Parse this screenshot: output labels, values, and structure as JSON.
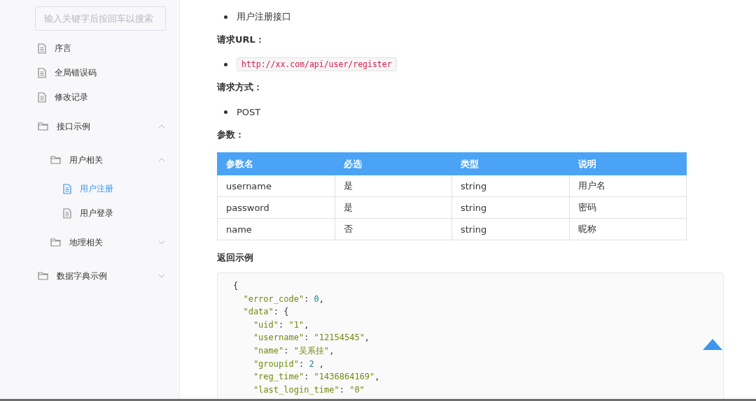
{
  "search": {
    "placeholder": "输入关键字后按回车以搜索"
  },
  "sidebar": {
    "items": [
      {
        "label": "序言",
        "kind": "document",
        "selected": false
      },
      {
        "label": "全局错误码",
        "kind": "document",
        "selected": false
      },
      {
        "label": "修改记录",
        "kind": "document",
        "selected": false
      },
      {
        "label": "接口示例",
        "kind": "folder",
        "expanded": true,
        "children": [
          {
            "label": "用户相关",
            "kind": "folder",
            "expanded": true,
            "children": [
              {
                "label": "用户注册",
                "kind": "document",
                "selected": true
              },
              {
                "label": "用户登录",
                "kind": "document",
                "selected": false
              }
            ]
          },
          {
            "label": "地理相关",
            "kind": "folder",
            "expanded": false
          }
        ]
      },
      {
        "label": "数据字典示例",
        "kind": "folder",
        "expanded": false
      }
    ]
  },
  "content": [
    {
      "kind": "bullet",
      "text": "用户注册接口"
    },
    {
      "kind": "heading",
      "text": "请求URL："
    },
    {
      "kind": "code_bullet",
      "text": "http://xx.com/api/user/register"
    },
    {
      "kind": "heading",
      "text": "请求方式："
    },
    {
      "kind": "bullet",
      "text": "POST"
    },
    {
      "kind": "heading",
      "text": "参数："
    },
    {
      "kind": "table",
      "columns": [
        "参数名",
        "必选",
        "类型",
        "说明"
      ],
      "rows": [
        [
          "username",
          "是",
          "string",
          "用户名"
        ],
        [
          "password",
          "是",
          "string",
          "密码"
        ],
        [
          "name",
          "否",
          "string",
          "昵称"
        ]
      ]
    },
    {
      "kind": "heading",
      "text": "返回示例"
    },
    {
      "kind": "code",
      "lines": [
        [
          {
            "text": "{",
            "kind": "punct"
          }
        ],
        [
          {
            "text": "  \"error_code\"",
            "kind": "string"
          },
          {
            "text": ": ",
            "kind": "punct"
          },
          {
            "text": "0",
            "kind": "number"
          },
          {
            "text": ",",
            "kind": "punct"
          }
        ],
        [
          {
            "text": "  \"data\"",
            "kind": "string"
          },
          {
            "text": ": {",
            "kind": "punct"
          }
        ],
        [
          {
            "text": "    \"uid\"",
            "kind": "string"
          },
          {
            "text": ": ",
            "kind": "punct"
          },
          {
            "text": "\"1\"",
            "kind": "string"
          },
          {
            "text": ",",
            "kind": "punct"
          }
        ],
        [
          {
            "text": "    \"username\"",
            "kind": "string"
          },
          {
            "text": ": ",
            "kind": "punct"
          },
          {
            "text": "\"12154545\"",
            "kind": "string"
          },
          {
            "text": ",",
            "kind": "punct"
          }
        ],
        [
          {
            "text": "    \"name\"",
            "kind": "string"
          },
          {
            "text": ": ",
            "kind": "punct"
          },
          {
            "text": "\"吴系挂\"",
            "kind": "string"
          },
          {
            "text": ",",
            "kind": "punct"
          }
        ],
        [
          {
            "text": "    \"groupid\"",
            "kind": "string"
          },
          {
            "text": ": ",
            "kind": "punct"
          },
          {
            "text": "2",
            "kind": "number"
          },
          {
            "text": " ,",
            "kind": "punct"
          }
        ],
        [
          {
            "text": "    \"reg_time\"",
            "kind": "string"
          },
          {
            "text": ": ",
            "kind": "punct"
          },
          {
            "text": "\"1436864169\"",
            "kind": "string"
          },
          {
            "text": ",",
            "kind": "punct"
          }
        ],
        [
          {
            "text": "    \"last_login_time\"",
            "kind": "string"
          },
          {
            "text": ": ",
            "kind": "punct"
          },
          {
            "text": "\"0\"",
            "kind": "string"
          }
        ]
      ]
    }
  ]
}
